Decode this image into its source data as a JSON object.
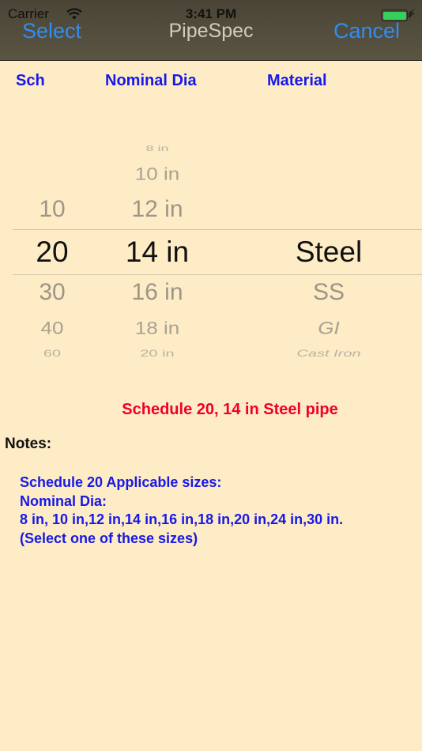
{
  "status": {
    "carrier": "Carrier",
    "time": "3:41 PM"
  },
  "nav": {
    "left": "Select",
    "title": "PipeSpec",
    "right": "Cancel"
  },
  "headers": {
    "sch": "Sch",
    "dia": "Nominal Dia",
    "mat": "Material"
  },
  "picker": {
    "sch": {
      "above1": "10",
      "selected": "20",
      "below1": "30",
      "below2": "40",
      "below3": "60"
    },
    "dia": {
      "above3": "8 in",
      "above2": "10 in",
      "above1": "12 in",
      "selected": "14 in",
      "below1": "16 in",
      "below2": "18 in",
      "below3": "20 in"
    },
    "mat": {
      "selected": "Steel",
      "below1": "SS",
      "below2": "GI",
      "below3": "Cast Iron"
    }
  },
  "result": "Schedule 20, 14 in Steel pipe",
  "notes": {
    "label": "Notes:",
    "line1": "Schedule 20 Applicable sizes:",
    "line2": "Nominal Dia:",
    "line3": "8 in, 10 in,12 in,14 in,16 in,18 in,20 in,24 in,30 in.",
    "line4": "(Select one of these sizes)"
  },
  "colors": {
    "background": "#fdecc5",
    "navbar": "#4f4a3b",
    "accent": "#2f8df4",
    "header_text": "#1818e8",
    "result_text": "#f0002a"
  }
}
